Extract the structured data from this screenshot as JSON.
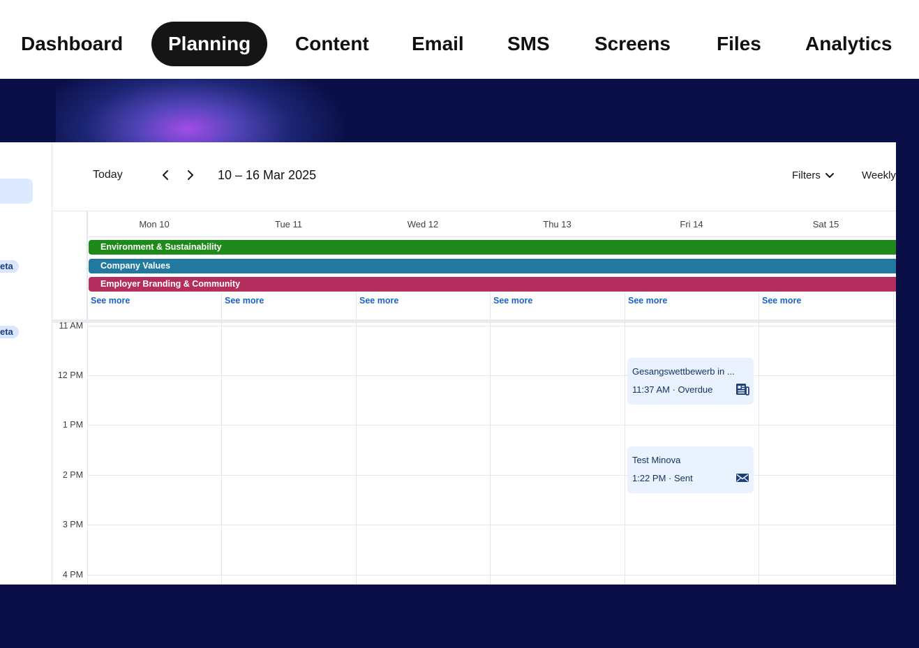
{
  "nav": {
    "items": [
      {
        "label": "Dashboard",
        "active": false
      },
      {
        "label": "Planning",
        "active": true
      },
      {
        "label": "Content",
        "active": false
      },
      {
        "label": "Email",
        "active": false
      },
      {
        "label": "SMS",
        "active": false
      },
      {
        "label": "Screens",
        "active": false
      },
      {
        "label": "Files",
        "active": false
      },
      {
        "label": "Analytics",
        "active": false
      }
    ]
  },
  "sidebar": {
    "badges": [
      "eta",
      "eta"
    ]
  },
  "calendar": {
    "today_label": "Today",
    "prev_icon": "chevron-left-icon",
    "next_icon": "chevron-right-icon",
    "date_range": "10 – 16 Mar 2025",
    "filters_label": "Filters",
    "filters_icon": "chevron-down-icon",
    "view_label": "Weekly",
    "days": [
      "Mon 10",
      "Tue 11",
      "Wed 12",
      "Thu 13",
      "Fri 14",
      "Sat 15"
    ],
    "all_day_events": [
      {
        "label": "Environment & Sustainability",
        "color": "#1e8a1a"
      },
      {
        "label": "Company Values",
        "color": "#21799f"
      },
      {
        "label": "Employer Branding & Community",
        "color": "#b32d5d"
      }
    ],
    "see_more_label": "See more",
    "hours": [
      "11 AM",
      "12 PM",
      "1 PM",
      "2 PM",
      "3 PM",
      "4 PM"
    ],
    "events": [
      {
        "title": "Gesangswettbewerb in ...",
        "time": "11:37 AM",
        "status": "Overdue",
        "day": "Fri 14",
        "icon": "newspaper-icon"
      },
      {
        "title": "Test Minova",
        "time": "1:22 PM",
        "status": "Sent",
        "day": "Fri 14",
        "icon": "envelope-icon"
      }
    ]
  },
  "colors": {
    "brand_navy": "#0b0f48",
    "active_nav_bg": "#151515",
    "link_blue": "#1a64c8",
    "event_bg": "#eaf2ff",
    "event_text": "#10325f"
  }
}
